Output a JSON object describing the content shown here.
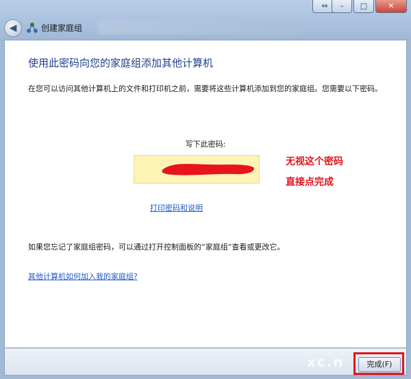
{
  "window": {
    "nav_title": "创建家庭组",
    "controls": {
      "help": "⇔",
      "minimize": "–",
      "maximize": "□",
      "close": "✕"
    },
    "back_symbol": "◀",
    "icons": [
      "back-arrow-icon",
      "homegroup-icon"
    ]
  },
  "main": {
    "heading": "使用此密码向您的家庭组添加其他计算机",
    "intro": "在您可以访问其他计算机上的文件和打印机之前，需要将这些计算机添加到您的家庭组。您需要以下密码。",
    "code_label": "写下此密码:",
    "print_link": "打印密码和说明",
    "forgot_text": "如果您忘记了家庭组密码，可以通过打开控制面板的“家庭组”查看或更改它。",
    "how_link": "其他计算机如何加入我的家庭组?"
  },
  "annotation": {
    "line1": "无视这个密码",
    "line2": "直接点完成",
    "color": "#e0141e"
  },
  "footer": {
    "finish_label": "完成(F)"
  },
  "watermark": "xc.n"
}
